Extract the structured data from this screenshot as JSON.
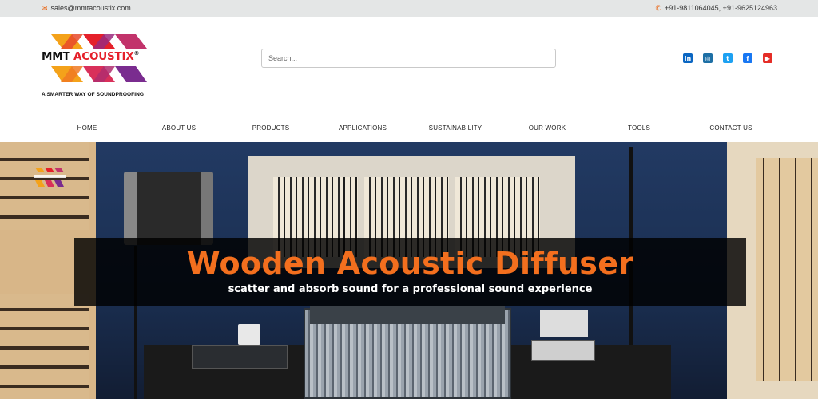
{
  "topbar": {
    "email": "sales@mmtacoustix.com",
    "email_icon": "envelope-icon",
    "phone": "+91-9811064045, +91-9625124963",
    "phone_icon": "phone-icon",
    "accent": "#e86a1c"
  },
  "brand": {
    "name_part1": "MMT",
    "name_part2": "ACOUSTIX",
    "registered": "®",
    "tagline": "A SMARTER WAY OF SOUNDPROOFING",
    "colors": [
      "#f4a21a",
      "#e5202a",
      "#7a2c8f"
    ]
  },
  "search": {
    "placeholder": "Search..."
  },
  "socials": [
    {
      "name": "linkedin-icon",
      "glyph": "in",
      "color": "#0a66c2"
    },
    {
      "name": "instagram-icon",
      "glyph": "◎",
      "color": "#1d6fa5"
    },
    {
      "name": "twitter-icon",
      "glyph": "t",
      "color": "#1da1f2"
    },
    {
      "name": "facebook-icon",
      "glyph": "f",
      "color": "#1877f2"
    },
    {
      "name": "youtube-icon",
      "glyph": "▶",
      "color": "#e52d27"
    }
  ],
  "nav": [
    "HOME",
    "ABOUT US",
    "PRODUCTS",
    "APPLICATIONS",
    "SUSTAINABILITY",
    "OUR WORK",
    "TOOLS",
    "CONTACT US"
  ],
  "hero": {
    "title": "Wooden Acoustic Diffuser",
    "subtitle": "scatter and absorb sound for a professional sound experience",
    "title_color": "#f36f1e"
  }
}
